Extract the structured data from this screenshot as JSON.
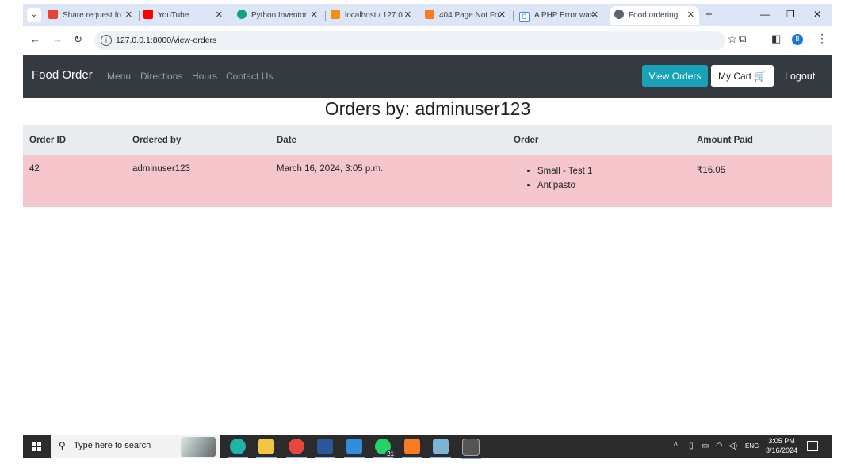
{
  "browser": {
    "tabs": [
      {
        "title": "Share request fo",
        "icon": "gmail-icon",
        "color": "#ea4335"
      },
      {
        "title": "YouTube",
        "icon": "youtube-icon",
        "color": "#ff0000"
      },
      {
        "title": "Python Inventor",
        "icon": "chatgpt-icon",
        "color": "#10a37f"
      },
      {
        "title": "localhost / 127.0",
        "icon": "phpmyadmin-icon",
        "color": "#f29111"
      },
      {
        "title": "404 Page Not Fo",
        "icon": "xampp-icon",
        "color": "#fb7a24"
      },
      {
        "title": "A PHP Error was",
        "icon": "google-icon",
        "color": "#4285f4"
      },
      {
        "title": "Food ordering",
        "icon": "globe-icon",
        "color": "#5f6368"
      }
    ],
    "url": "127.0.0.1:8000/view-orders",
    "profile_initial": "B"
  },
  "site": {
    "brand": "Food Order",
    "nav": [
      "Menu",
      "Directions",
      "Hours",
      "Contact Us"
    ],
    "view_orders": "View Orders",
    "my_cart": "My Cart",
    "logout": "Logout",
    "accent": "#17a2b8"
  },
  "page": {
    "title": "Orders by: adminuser123",
    "columns": [
      "Order ID",
      "Ordered by",
      "Date",
      "Order",
      "Amount Paid"
    ],
    "rows": [
      {
        "id": "42",
        "user": "adminuser123",
        "date": "March 16, 2024, 3:05 p.m.",
        "items": [
          "Small - Test 1",
          "Antipasto"
        ],
        "amount": "₹16.05"
      }
    ]
  },
  "taskbar": {
    "search_placeholder": "Type here to search",
    "whatsapp_badge": "21",
    "lang": "ENG",
    "time": "3:05 PM",
    "date": "3/16/2024"
  }
}
